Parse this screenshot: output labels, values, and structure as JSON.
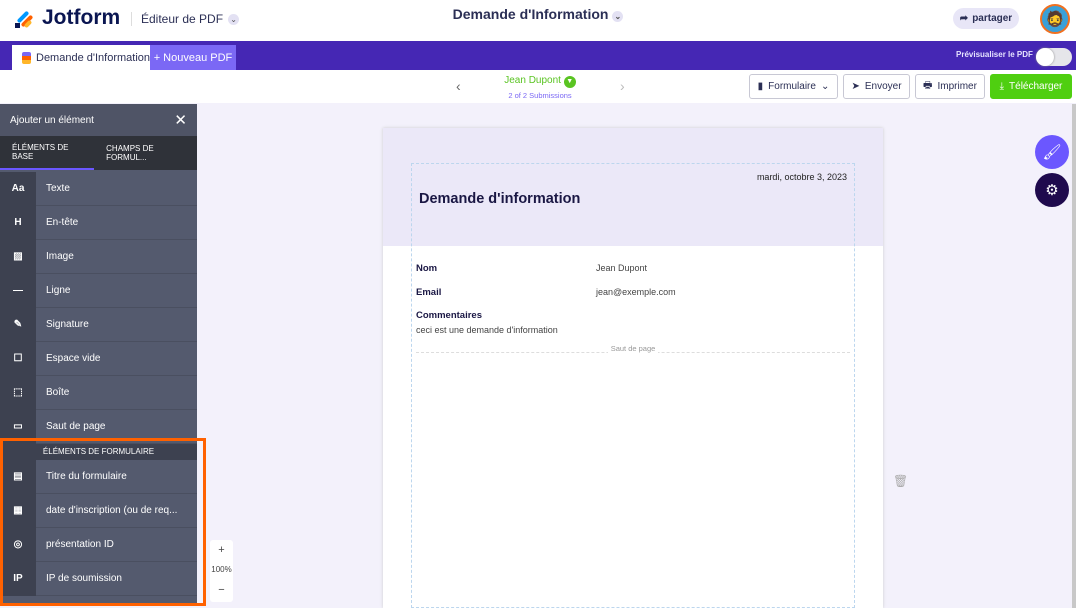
{
  "header": {
    "brand": "Jotform",
    "editor": "Éditeur de PDF",
    "title": "Demande d'Information",
    "share": "partager"
  },
  "tabs": {
    "active": "Demande d'Information",
    "new": "+ Nouveau PDF",
    "preview": "Prévisualiser le PDF"
  },
  "submission": {
    "name": "Jean Dupont",
    "count": "2 of 2 Submissions"
  },
  "toolbar": {
    "form": "Formulaire",
    "send": "Envoyer",
    "print": "Imprimer",
    "download": "Télécharger"
  },
  "sidebar": {
    "title": "Ajouter un élément",
    "tab_basic": "ÉLÉMENTS DE BASE",
    "tab_fields": "CHAMPS DE FORMUL...",
    "basic": [
      {
        "icon": "Aa",
        "label": "Texte"
      },
      {
        "icon": "H",
        "label": "En-tête"
      },
      {
        "icon": "▨",
        "label": "Image"
      },
      {
        "icon": "—",
        "label": "Ligne"
      },
      {
        "icon": "✎",
        "label": "Signature"
      },
      {
        "icon": "☐",
        "label": "Espace vide"
      },
      {
        "icon": "⬚",
        "label": "Boîte"
      },
      {
        "icon": "▭",
        "label": "Saut de page"
      }
    ],
    "section": "ÉLÉMENTS DE FORMULAIRE",
    "form": [
      {
        "icon": "▤",
        "label": "Titre du formulaire"
      },
      {
        "icon": "▦",
        "label": "date d'inscription (ou de req..."
      },
      {
        "icon": "◎",
        "label": "présentation ID"
      },
      {
        "icon": "IP",
        "label": "IP de soumission"
      }
    ]
  },
  "zoom": {
    "plus": "+",
    "level": "100%",
    "minus": "−"
  },
  "document": {
    "date": "mardi, octobre 3, 2023",
    "title": "Demande d'information",
    "fields": [
      {
        "label": "Nom",
        "value": "Jean Dupont"
      },
      {
        "label": "Email",
        "value": "jean@exemple.com"
      }
    ],
    "comments_label": "Commentaires",
    "comments_value": "ceci est une demande d'information",
    "page_break": "Saut de page"
  }
}
